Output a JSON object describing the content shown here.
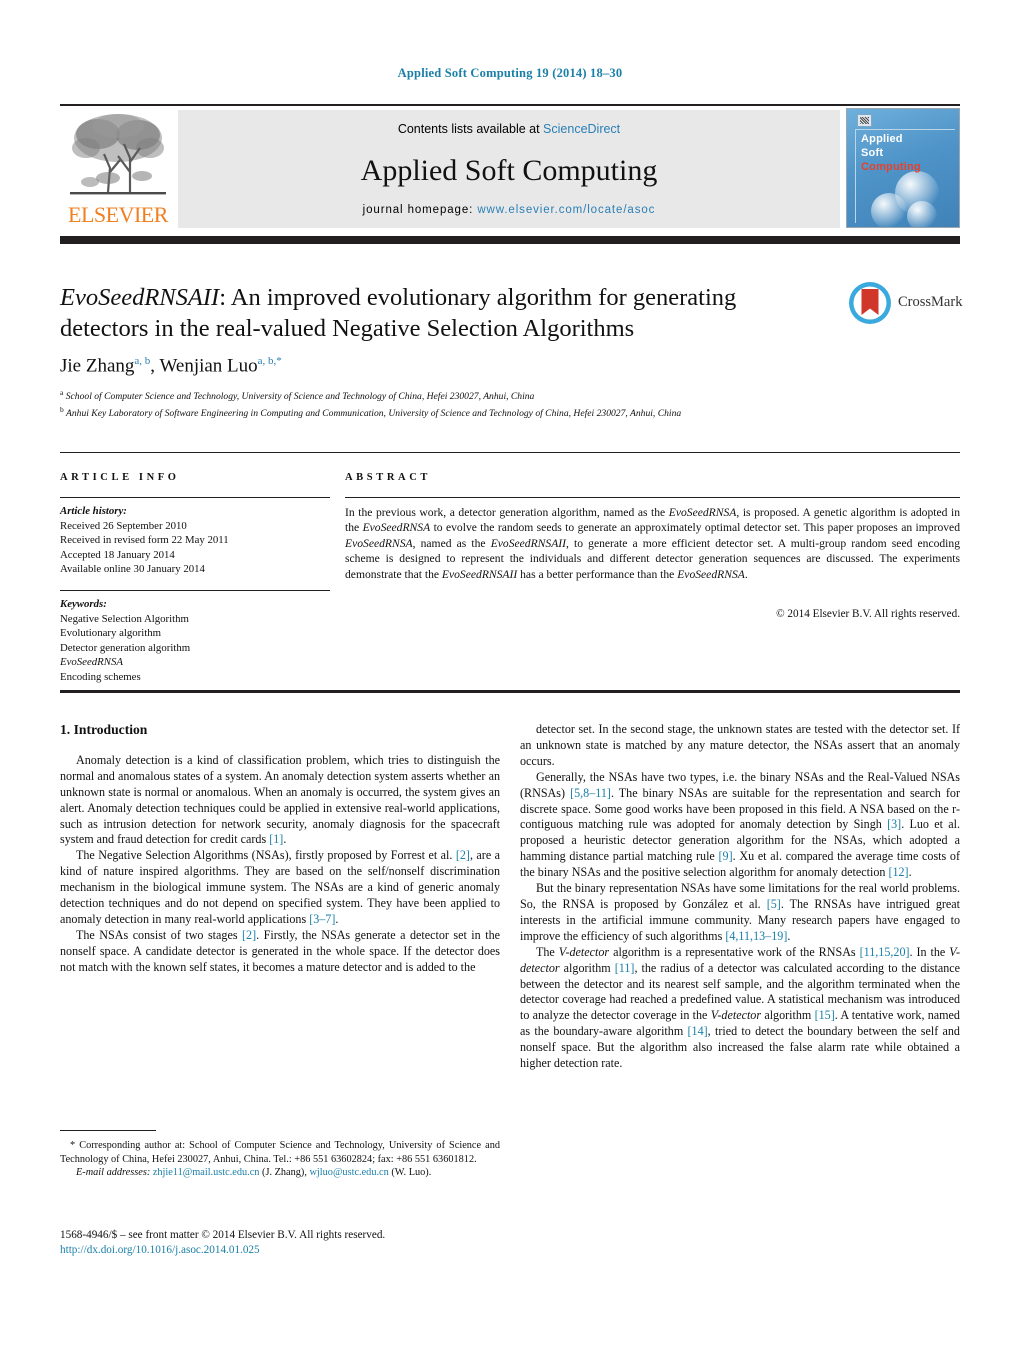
{
  "running_head": "Applied Soft Computing 19 (2014) 18–30",
  "banner": {
    "contents_prefix": "Contents lists available at ",
    "sciencedirect": "ScienceDirect",
    "journal_title": "Applied Soft Computing",
    "homepage_label": "journal homepage:",
    "homepage_url": "www.elsevier.com/locate/asoc",
    "publisher_logo_text": "ELSEVIER",
    "cover": {
      "line1": "Applied",
      "line2": "Soft",
      "line3": "Computing"
    }
  },
  "article": {
    "title_italic": "EvoSeedRNSAII",
    "title_rest": ": An improved evolutionary algorithm for generating detectors in the real-valued Negative Selection Algorithms",
    "authors": [
      {
        "name": "Jie Zhang",
        "sup": "a, b"
      },
      {
        "name": "Wenjian Luo",
        "sup": "a, b,*"
      }
    ],
    "affiliations": [
      {
        "marker": "a",
        "text": "School of Computer Science and Technology, University of Science and Technology of China, Hefei 230027, Anhui, China"
      },
      {
        "marker": "b",
        "text": "Anhui Key Laboratory of Software Engineering in Computing and Communication, University of Science and Technology of China, Hefei 230027, Anhui, China"
      }
    ],
    "crossmark_label": "CrossMark"
  },
  "article_info": {
    "heading": "ARTICLE INFO",
    "history_label": "Article history:",
    "history": [
      "Received 26 September 2010",
      "Received in revised form 22 May 2011",
      "Accepted 18 January 2014",
      "Available online 30 January 2014"
    ],
    "keywords_label": "Keywords:",
    "keywords": [
      "Negative Selection Algorithm",
      "Evolutionary algorithm",
      "Detector generation algorithm",
      "EvoSeedRNSA",
      "Encoding schemes"
    ],
    "keyword_italic_index": 3
  },
  "abstract": {
    "heading": "ABSTRACT",
    "paragraph_parts": [
      {
        "t": "In the previous work, a detector generation algorithm, named as the ",
        "i": false
      },
      {
        "t": "EvoSeedRNSA",
        "i": true
      },
      {
        "t": ", is proposed. A genetic algorithm is adopted in the ",
        "i": false
      },
      {
        "t": "EvoSeedRNSA",
        "i": true
      },
      {
        "t": " to evolve the random seeds to generate an approximately optimal detector set. This paper proposes an improved ",
        "i": false
      },
      {
        "t": "EvoSeedRNSA",
        "i": true
      },
      {
        "t": ", named as the ",
        "i": false
      },
      {
        "t": "EvoSeedRNSAII",
        "i": true
      },
      {
        "t": ", to generate a more efficient detector set. A multi-group random seed encoding scheme is designed to represent the individuals and different detector generation sequences are discussed. The experiments demonstrate that the ",
        "i": false
      },
      {
        "t": "EvoSeedRNSAII",
        "i": true
      },
      {
        "t": " has a better performance than the ",
        "i": false
      },
      {
        "t": "EvoSeedRNSA",
        "i": true
      },
      {
        "t": ".",
        "i": false
      }
    ],
    "copyright": "© 2014 Elsevier B.V. All rights reserved."
  },
  "body": {
    "section_heading": "1. Introduction",
    "left_paragraphs": [
      [
        {
          "t": "Anomaly detection is a kind of classification problem, which tries to distinguish the normal and anomalous states of a system. An anomaly detection system asserts whether an unknown state is normal or anomalous. When an anomaly is occurred, the system gives an alert. Anomaly detection techniques could be applied in extensive real-world applications, such as intrusion detection for network security, anomaly diagnosis for the spacecraft system and fraud detection for credit cards ",
          "k": "n"
        },
        {
          "t": "[1]",
          "k": "r"
        },
        {
          "t": ".",
          "k": "n"
        }
      ],
      [
        {
          "t": "The Negative Selection Algorithms (NSAs), firstly proposed by Forrest et al. ",
          "k": "n"
        },
        {
          "t": "[2]",
          "k": "r"
        },
        {
          "t": ", are a kind of nature inspired algorithms. They are based on the self/nonself discrimination mechanism in the biological immune system. The NSAs are a kind of generic anomaly detection techniques and do not depend on specified system. They have been applied to anomaly detection in many real-world applications ",
          "k": "n"
        },
        {
          "t": "[3–7]",
          "k": "r"
        },
        {
          "t": ".",
          "k": "n"
        }
      ],
      [
        {
          "t": "The NSAs consist of two stages ",
          "k": "n"
        },
        {
          "t": "[2]",
          "k": "r"
        },
        {
          "t": ". Firstly, the NSAs generate a detector set in the nonself space. A candidate detector is generated in the whole space. If the detector does not match with the known self states, it becomes a mature detector and is added to the",
          "k": "n"
        }
      ]
    ],
    "right_paragraphs": [
      [
        {
          "t": "detector set. In the second stage, the unknown states are tested with the detector set. If an unknown state is matched by any mature detector, the NSAs assert that an anomaly occurs.",
          "k": "n"
        }
      ],
      [
        {
          "t": "Generally, the NSAs have two types, i.e. the binary NSAs and the Real-Valued NSAs (RNSAs) ",
          "k": "n"
        },
        {
          "t": "[5,8–11]",
          "k": "r"
        },
        {
          "t": ". The binary NSAs are suitable for the representation and search for discrete space. Some good works have been proposed in this field. A NSA based on the r-contiguous matching rule was adopted for anomaly detection by Singh ",
          "k": "n"
        },
        {
          "t": "[3]",
          "k": "r"
        },
        {
          "t": ". Luo et al. proposed a heuristic detector generation algorithm for the NSAs, which adopted a hamming distance partial matching rule ",
          "k": "n"
        },
        {
          "t": "[9]",
          "k": "r"
        },
        {
          "t": ". Xu et al. compared the average time costs of the binary NSAs and the positive selection algorithm for anomaly detection ",
          "k": "n"
        },
        {
          "t": "[12]",
          "k": "r"
        },
        {
          "t": ".",
          "k": "n"
        }
      ],
      [
        {
          "t": "But the binary representation NSAs have some limitations for the real world problems. So, the RNSA is proposed by González et al. ",
          "k": "n"
        },
        {
          "t": "[5]",
          "k": "r"
        },
        {
          "t": ". The RNSAs have intrigued great interests in the artificial immune community. Many research papers have engaged to improve the efficiency of such algorithms ",
          "k": "n"
        },
        {
          "t": "[4,11,13–19]",
          "k": "r"
        },
        {
          "t": ".",
          "k": "n"
        }
      ],
      [
        {
          "t": "The ",
          "k": "n"
        },
        {
          "t": "V-detector",
          "k": "i"
        },
        {
          "t": " algorithm is a representative work of the RNSAs ",
          "k": "n"
        },
        {
          "t": "[11,15,20]",
          "k": "r"
        },
        {
          "t": ". In the ",
          "k": "n"
        },
        {
          "t": "V-detector",
          "k": "i"
        },
        {
          "t": " algorithm ",
          "k": "n"
        },
        {
          "t": "[11]",
          "k": "r"
        },
        {
          "t": ", the radius of a detector was calculated according to the distance between the detector and its nearest self sample, and the algorithm terminated when the detector coverage had reached a predefined value. A statistical mechanism was introduced to analyze the detector coverage in the ",
          "k": "n"
        },
        {
          "t": "V-detector",
          "k": "i"
        },
        {
          "t": " algorithm ",
          "k": "n"
        },
        {
          "t": "[15]",
          "k": "r"
        },
        {
          "t": ". A tentative work, named as the boundary-aware algorithm ",
          "k": "n"
        },
        {
          "t": "[14]",
          "k": "r"
        },
        {
          "t": ", tried to detect the boundary between the self and nonself space. But the algorithm also increased the false alarm rate while obtained a higher detection rate.",
          "k": "n"
        }
      ]
    ]
  },
  "footnote": {
    "star": "*",
    "corresponding": " Corresponding author at: School of Computer Science and Technology, University of Science and Technology of China, Hefei 230027, Anhui, China. Tel.: +86 551 63602824; fax: +86 551 63601812.",
    "email_label": "E-mail addresses:",
    "emails": [
      {
        "addr": "zhjie11@mail.ustc.edu.cn",
        "who": " (J. Zhang),"
      },
      {
        "addr": "wjluo@ustc.edu.cn",
        "who": " (W. Luo)."
      }
    ]
  },
  "frontmatter": {
    "line1": "1568-4946/$ – see front matter © 2014 Elsevier B.V. All rights reserved.",
    "doi": "http://dx.doi.org/10.1016/j.asoc.2014.01.025"
  },
  "colors": {
    "link": "#1a7fa8",
    "sciencedirect": "#2a7fb5",
    "elsevier_orange": "#f07f20",
    "cover_red": "#e8402a",
    "rule": "#231f20"
  }
}
